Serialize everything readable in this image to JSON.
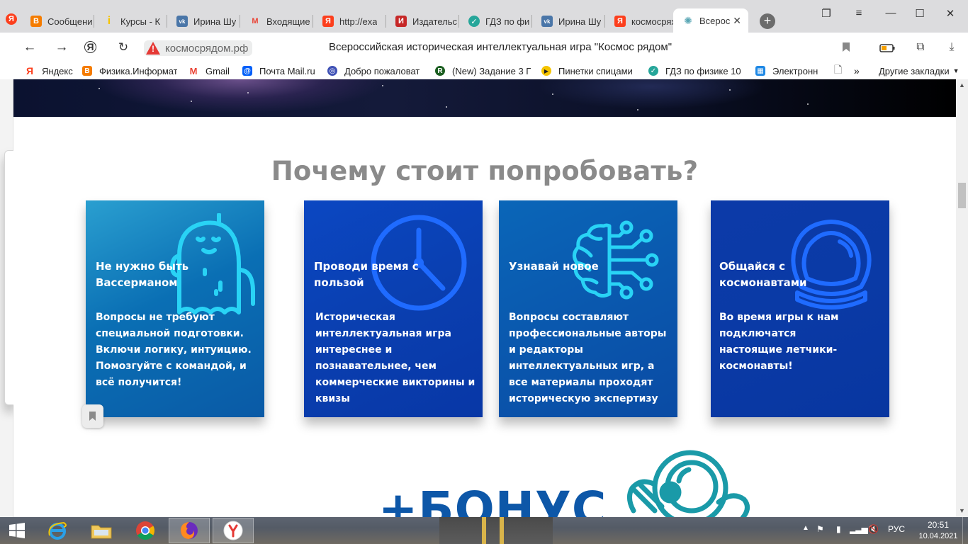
{
  "browser": {
    "tabs": [
      {
        "label": "Сообщени",
        "icon": "blogger-icon",
        "color": "#f57c00",
        "glyph": "B"
      },
      {
        "label": "Курсы - К",
        "icon": "info-icon",
        "color": "#f5c400",
        "glyph": "i"
      },
      {
        "label": "Ирина Шу",
        "icon": "vk-icon",
        "color": "#4a76a8",
        "glyph": "vk"
      },
      {
        "label": "Входящие",
        "icon": "gmail-icon",
        "color": "#ea4335",
        "glyph": "M"
      },
      {
        "label": "http://exa",
        "icon": "yandex-icon",
        "color": "#fc3f1d",
        "glyph": "Я"
      },
      {
        "label": "Издательс",
        "icon": "publisher-icon",
        "color": "#c62828",
        "glyph": "И"
      },
      {
        "label": "ГДЗ по фи",
        "icon": "gdz-icon",
        "color": "#26a69a",
        "glyph": "✓"
      },
      {
        "label": "Ирина Шу",
        "icon": "vk-icon",
        "color": "#4a76a8",
        "glyph": "vk"
      },
      {
        "label": "космосрях",
        "icon": "yandex-icon",
        "color": "#fc3f1d",
        "glyph": "Я"
      },
      {
        "label": "Всерос",
        "icon": "kosmos-icon",
        "color": "#5aa7b5",
        "glyph": "✺",
        "active": true
      }
    ],
    "url": "космосрядом.рф",
    "page_title": "Всероссийская историческая интеллектуальная игра \"Космос рядом\"",
    "bookmarks": [
      {
        "label": "Яндекс",
        "icon": "yandex-icon",
        "color": "#fc3f1d",
        "glyph": "Я"
      },
      {
        "label": "Физика.Информат",
        "icon": "blogger-icon",
        "color": "#f57c00",
        "glyph": "B"
      },
      {
        "label": "Gmail",
        "icon": "gmail-icon",
        "color": "#ea4335",
        "glyph": "M"
      },
      {
        "label": "Почта Mail.ru",
        "icon": "mail-icon",
        "color": "#005ff9",
        "glyph": "@"
      },
      {
        "label": "Добро пожаловат",
        "icon": "globe-icon",
        "color": "#3f51b5",
        "glyph": "◎"
      },
      {
        "label": "(New) Задание 3 Г",
        "icon": "r-icon",
        "color": "#1b5e20",
        "glyph": "R"
      },
      {
        "label": "Пинетки спицами",
        "icon": "play-icon",
        "color": "#f5c400",
        "glyph": "▶"
      },
      {
        "label": "ГДЗ по физике 10",
        "icon": "gdz-icon",
        "color": "#26a69a",
        "glyph": "✓"
      },
      {
        "label": "Электронн",
        "icon": "calendar-icon",
        "color": "#1e88e5",
        "glyph": "▦"
      }
    ],
    "other_bookmarks": "Другие закладки"
  },
  "page": {
    "section_title": "Почему стоит попробовать?",
    "cards": [
      {
        "title": "Не нужно быть Вассерманом",
        "text": "Вопросы не требуют специальной подготовки. Включи логику, интуицию. Помозгуйте с командой, и всё получится!"
      },
      {
        "title": "Проводи время с пользой",
        "text": "Историческая интеллектуальная игра интереснее и познавательнее, чем коммерческие викторины и квизы"
      },
      {
        "title": "Узнавай новое",
        "text": "Вопросы составляют профессиональные авторы и редакторы интеллектуальных игр, а все материалы проходят историческую экспертизу"
      },
      {
        "title": "Общайся с космонавтами",
        "text": "Во время игры к нам подключатся настоящие летчики-космонавты!"
      }
    ],
    "bonus": "+БОНУС"
  },
  "taskbar": {
    "language": "РУС",
    "time": "20:51",
    "date": "10.04.2021"
  },
  "colors": {
    "title_gray": "#8a8a8a",
    "icon_cyan": "#29d3f5",
    "icon_blue": "#1f6bff",
    "bonus_blue": "#0d57a8"
  }
}
